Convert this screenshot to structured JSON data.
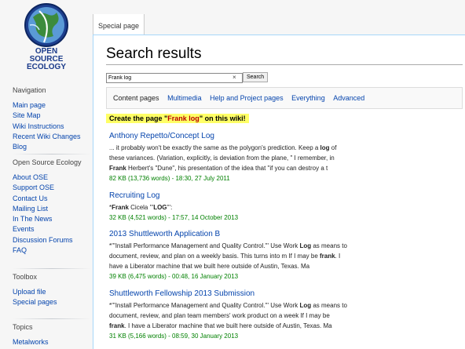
{
  "logo": {
    "line1": "OPEN",
    "line2": "SOURCE",
    "line3": "ECOLOGY",
    "color": "#1a3a8a"
  },
  "sidebar": {
    "navigation": {
      "heading": "Navigation",
      "items": [
        "Main page",
        "Site Map",
        "Wiki Instructions",
        "Recent Wiki Changes",
        "Blog"
      ]
    },
    "ose": {
      "heading": "Open Source Ecology",
      "items": [
        "About OSE",
        "Support OSE",
        "Contact Us",
        "Mailing List",
        "In The News",
        "Events",
        "Discussion Forums",
        "FAQ"
      ]
    },
    "toolbox": {
      "heading": "Toolbox",
      "items": [
        "Upload file",
        "Special pages"
      ]
    },
    "topics": {
      "heading": "Topics",
      "items": [
        "Metalworks"
      ]
    }
  },
  "tab": {
    "label": "Special page"
  },
  "page": {
    "title": "Search results"
  },
  "search": {
    "value": "Frank log",
    "button": "Search",
    "clear": "×"
  },
  "profiles": {
    "active": "Content pages",
    "links": [
      "Multimedia",
      "Help and Project pages",
      "Everything",
      "Advanced"
    ]
  },
  "create": {
    "prefix": "Create the page \"",
    "page": "Frank log",
    "suffix": "\" on this wiki!"
  },
  "results": [
    {
      "title": "Anthony Repetto/Concept Log",
      "snippet": [
        [
          [
            "... it probably won't be exactly the same as the polygon's prediction. Keep a ",
            false
          ],
          [
            "log",
            true
          ],
          [
            " of",
            false
          ]
        ],
        [
          [
            "these variances. (Variation, explicitly, is deviation from the plane, \" I remember, in",
            false
          ]
        ],
        [
          [
            "Frank",
            true
          ],
          [
            " Herbert's \"Dune\", his presentation of the idea that \"if you can destroy a t",
            false
          ]
        ]
      ],
      "meta": "82 KB (13,736 words) - 18:30, 27 July 2011"
    },
    {
      "title": "Recruiting Log",
      "snippet": [
        [
          [
            "*",
            false
          ],
          [
            "Frank",
            true
          ],
          [
            " Cicela '''",
            false
          ],
          [
            "LOG",
            true
          ],
          [
            "''':",
            false
          ]
        ]
      ],
      "meta": "32 KB (4,521 words) - 17:57, 14 October 2013"
    },
    {
      "title": "2013 Shuttleworth Application B",
      "snippet": [
        [
          [
            "*'''Install Performance Management and Quality Control.''' Use Work ",
            false
          ],
          [
            "Log",
            true
          ],
          [
            " as means to",
            false
          ]
        ],
        [
          [
            "document, review, and plan on a weekly basis. This turns into m If I may be ",
            false
          ],
          [
            "frank",
            true
          ],
          [
            ". I",
            false
          ]
        ],
        [
          [
            "have a Liberator machine that we built here outside of Austin, Texas. Ma",
            false
          ]
        ]
      ],
      "meta": "39 KB (6,475 words) - 00:48, 16 January 2013"
    },
    {
      "title": "Shuttleworth Fellowship 2013 Submission",
      "snippet": [
        [
          [
            "*'''Install Performance Management and Quality Control.''' Use Work ",
            false
          ],
          [
            "Log",
            true
          ],
          [
            " as means to",
            false
          ]
        ],
        [
          [
            "document, review, and plan team members' work product on a week If I may be",
            false
          ]
        ],
        [
          [
            "frank",
            true
          ],
          [
            ". I have a Liberator machine that we built here outside of Austin, Texas. Ma",
            false
          ]
        ]
      ],
      "meta": "31 KB (5,166 words) - 08:59, 30 January 2013"
    }
  ]
}
